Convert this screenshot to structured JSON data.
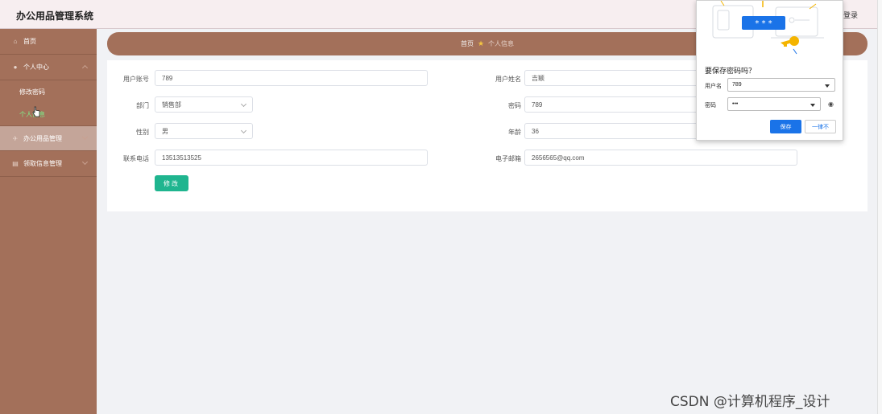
{
  "header": {
    "title": "办公用品管理系统",
    "logout": "登录"
  },
  "sidebar": {
    "items": [
      {
        "label": "首页",
        "icon": "home-icon",
        "glyph": "⌂"
      },
      {
        "label": "个人中心",
        "icon": "user-icon",
        "glyph": "●"
      },
      {
        "label": "办公用品管理",
        "icon": "send-icon",
        "glyph": "✈"
      },
      {
        "label": "领取信息管理",
        "icon": "list-icon",
        "glyph": "▤"
      }
    ],
    "subitems": [
      {
        "label": "修改密码"
      },
      {
        "label": "个人信息"
      }
    ]
  },
  "breadcrumb": {
    "home": "首页",
    "current": "个人信息"
  },
  "form": {
    "account_label": "用户账号",
    "account_value": "789",
    "name_label": "用户姓名",
    "name_value": "吉颖",
    "dept_label": "部门",
    "dept_value": "销售部",
    "password_label": "密码",
    "password_value": "789",
    "gender_label": "性别",
    "gender_value": "男",
    "age_label": "年龄",
    "age_value": "36",
    "phone_label": "联系电话",
    "phone_value": "13513513525",
    "email_label": "电子邮箱",
    "email_value": "2656565@qq.com",
    "submit": "修改"
  },
  "password_popup": {
    "title": "要保存密码吗？",
    "username_label": "用户名",
    "username_value": "789",
    "password_label": "密码",
    "password_value": "•••",
    "save": "保存",
    "never": "一律不",
    "illus_text": "* * *"
  },
  "watermark": "CSDN @计算机程序_设计",
  "colors": {
    "sidebar": "#a3705a",
    "accent_button": "#1fb58f",
    "popup_primary": "#1a73e8"
  }
}
